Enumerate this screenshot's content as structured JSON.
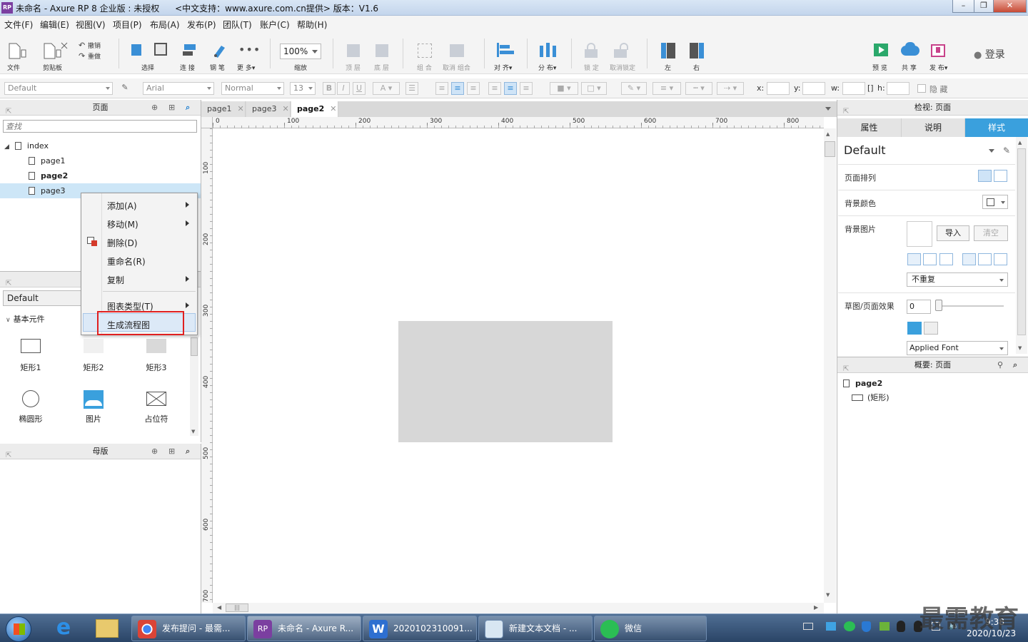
{
  "titlebar": {
    "app_icon": "RP",
    "title": "未命名 - Axure RP 8 企业版 : 未授权",
    "support": "<中文支持：www.axure.com.cn提供> 版本：V1.6"
  },
  "menubar": [
    "文件(F)",
    "编辑(E)",
    "视图(V)",
    "项目(P)",
    "布局(A)",
    "发布(P)",
    "团队(T)",
    "账户(C)",
    "帮助(H)"
  ],
  "toolbar": {
    "file": "文件",
    "clipboard": "剪贴板",
    "undo": "撤销",
    "redo": "重做",
    "select": "选择",
    "connect": "连 接",
    "pen": "钢 笔",
    "more": "更 多▾",
    "zoom_value": "100%",
    "zoom": "缩放",
    "top": "顶 层",
    "bottom": "底 层",
    "group": "组 合",
    "ungroup": "取消 组合",
    "align": "对 齐▾",
    "distribute": "分 布▾",
    "lock": "锁 定",
    "unlock": "取消锁定",
    "left": "左",
    "right": "右",
    "preview": "预 览",
    "share": "共 享",
    "publish": "发 布▾",
    "login": "登录"
  },
  "format": {
    "style": "Default",
    "font": "Arial",
    "weight": "Normal",
    "size": "13",
    "x_label": "x:",
    "y_label": "y:",
    "w_label": "w:",
    "h_label": "h:",
    "hidden": "隐 藏"
  },
  "pages_panel": {
    "title": "页面",
    "search_placeholder": "查找",
    "root": "index",
    "pages": [
      "page1",
      "page2",
      "page3"
    ]
  },
  "context_menu": {
    "items": [
      "添加(A)",
      "移动(M)",
      "删除(D)",
      "重命名(R)",
      "复制",
      "图表类型(T)",
      "生成流程图"
    ]
  },
  "library_panel": {
    "library": "Default",
    "group": "基本元件",
    "widgets": [
      "矩形1",
      "矩形2",
      "矩形3",
      "椭圆形",
      "图片",
      "占位符"
    ]
  },
  "masters_panel": {
    "title": "母版"
  },
  "tabs": [
    "page1",
    "page3",
    "page2"
  ],
  "ruler_top": [
    "0",
    "100",
    "200",
    "300",
    "400",
    "500",
    "600",
    "700",
    "800"
  ],
  "ruler_left": [
    "100",
    "200",
    "300",
    "400",
    "500",
    "600",
    "700"
  ],
  "inspector": {
    "title": "检视: 页面",
    "tabs": [
      "属性",
      "说明",
      "样式"
    ],
    "style_name": "Default",
    "page_align": "页面排列",
    "bg_color": "背景颜色",
    "bg_image": "背景图片",
    "import": "导入",
    "clear": "清空",
    "repeat": "不重复",
    "sketch": "草图/页面效果",
    "sketch_value": "0",
    "font": "Applied Font"
  },
  "outline": {
    "title": "概要: 页面",
    "page": "page2",
    "item": "(矩形)"
  },
  "taskbar": {
    "apps": [
      "发布提问 - 最需...",
      "未命名 - Axure R...",
      "2020102310091...",
      "新建文本文档 - ...",
      "微信"
    ],
    "time": "9:38",
    "date": "2020/10/23",
    "watermark": "最需教育"
  },
  "colors": {
    "accent": "#3aa0dd",
    "highlight_border": "#e02020",
    "canvas_rect": "#d7d7d7",
    "selected_row": "#cde6f7"
  }
}
